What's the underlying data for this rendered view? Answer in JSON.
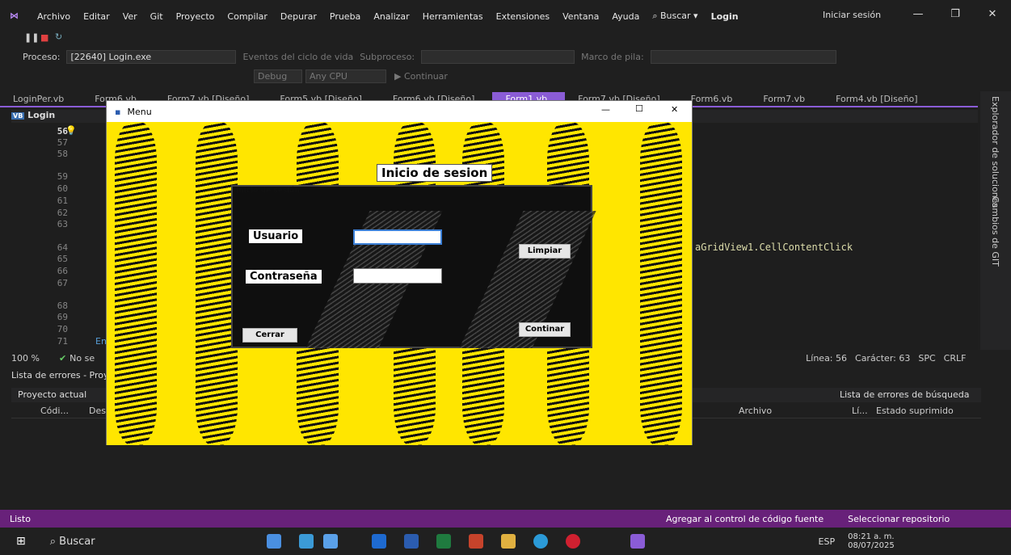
{
  "menubar": {
    "items": [
      "Archivo",
      "Editar",
      "Ver",
      "Git",
      "Proyecto",
      "Compilar",
      "Depurar",
      "Prueba",
      "Analizar",
      "Herramientas",
      "Extensiones",
      "Ventana",
      "Ayuda"
    ],
    "search": "Buscar",
    "solution": "Login",
    "signin": "Iniciar sesión"
  },
  "toolbar": {
    "proceso_label": "Proceso:",
    "proceso_value": "[22640] Login.exe",
    "eventos": "Eventos del ciclo de vida",
    "subproceso": "Subproceso:",
    "marco": "Marco de pila:",
    "config": "Debug",
    "platform": "Any CPU",
    "continuar": "Continuar"
  },
  "tabs": [
    "LoginPer.vb",
    "Form6.vb",
    "Form7.vb [Diseño]",
    "Form5.vb [Diseño]",
    "Form6.vb [Diseño]",
    "Form1.vb",
    "Form7.vb [Diseño]",
    "Form6.vb",
    "Form7.vb",
    "Form4.vb [Diseño]"
  ],
  "editor": {
    "file": "Login",
    "lines": [
      "56",
      "57",
      "58",
      "59",
      "60",
      "61",
      "62",
      "63",
      "64",
      "65",
      "66",
      "67",
      "68",
      "69",
      "70",
      "71"
    ],
    "code_line": "aGridView1.CellContentClick",
    "partial": "En"
  },
  "side": {
    "explorer": "Explorador de soluciones",
    "git": "Cambios de GIT"
  },
  "status": {
    "zoom": "100 %",
    "issues": "No se",
    "linea": "Línea: 56",
    "caracter": "Carácter: 63",
    "spc": "SPC",
    "crlf": "CRLF"
  },
  "errors": {
    "title": "Lista de errores - Proyec",
    "scope": "Proyecto actual",
    "search": "Lista de errores de búsqueda",
    "cols": [
      "Códi...",
      "Desc",
      "Archivo",
      "Lí...",
      "Estado suprimido"
    ]
  },
  "vsstatus": {
    "ready": "Listo",
    "add": "Agregar al control de código fuente",
    "repo": "Seleccionar repositorio"
  },
  "taskbar": {
    "search": "Buscar",
    "lang": "ESP",
    "time": "08:21 a. m.",
    "date": "08/07/2025"
  },
  "form": {
    "title": "Menu",
    "heading": "Inicio de sesion",
    "group": "Inicio de sesión",
    "usuario": "Usuario",
    "contrasena": "Contraseña",
    "limpiar": "Limpiar",
    "continuar": "Continar",
    "cerrar": "Cerrar",
    "min": "—",
    "max": "☐",
    "close": "✕"
  },
  "colors": {
    "accent": "#8a5cd6",
    "yellow": "#ffe600",
    "statusbar": "#68217a"
  }
}
